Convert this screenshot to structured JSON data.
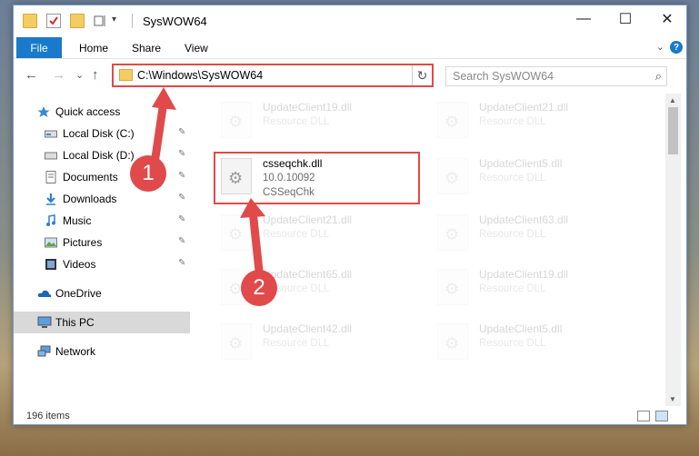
{
  "window": {
    "title": "SysWOW64",
    "minimize": "—",
    "maximize": "☐",
    "close": "✕"
  },
  "ribbon": {
    "tabs": [
      "File",
      "Home",
      "Share",
      "View"
    ],
    "expand": "⌄",
    "help": "?"
  },
  "nav": {
    "back": "←",
    "forward": "→",
    "recent": "⌄",
    "up": "↑",
    "address": "C:\\Windows\\SysWOW64",
    "refresh": "↻",
    "address_dropdown": "⌄",
    "search_placeholder": "Search SysWOW64",
    "search_icon": "⌕"
  },
  "sidebar": {
    "items": [
      {
        "label": "Quick access",
        "icon": "star-icon",
        "pinned": false
      },
      {
        "label": "Local Disk (C:)",
        "icon": "drive-icon",
        "pinned": true
      },
      {
        "label": "Local Disk (D:)",
        "icon": "drive-icon",
        "pinned": true
      },
      {
        "label": "Documents",
        "icon": "documents-icon",
        "pinned": true
      },
      {
        "label": "Downloads",
        "icon": "download-icon",
        "pinned": true
      },
      {
        "label": "Music",
        "icon": "music-icon",
        "pinned": true
      },
      {
        "label": "Pictures",
        "icon": "pictures-icon",
        "pinned": true
      },
      {
        "label": "Videos",
        "icon": "videos-icon",
        "pinned": true
      },
      {
        "label": "OneDrive",
        "icon": "cloud-icon",
        "pinned": false
      },
      {
        "label": "This PC",
        "icon": "pc-icon",
        "pinned": false,
        "selected": true
      },
      {
        "label": "Network",
        "icon": "network-icon",
        "pinned": false
      }
    ],
    "pin_glyph": "📌"
  },
  "files": [
    {
      "name": "UpdateClient19.dll",
      "desc": "Resource DLL",
      "faded": true
    },
    {
      "name": "UpdateClient21.dll",
      "desc": "Resource DLL",
      "faded": true
    },
    {
      "name": "csseqchk.dll",
      "desc": "10.0.10092",
      "desc2": "CSSeqChk",
      "faded": false
    },
    {
      "name": "UpdateClient5.dll",
      "desc": "Resource DLL",
      "faded": true
    },
    {
      "name": "UpdateClient21.dll",
      "desc": "Resource DLL",
      "faded": true
    },
    {
      "name": "UpdateClient63.dll",
      "desc": "Resource DLL",
      "faded": true
    },
    {
      "name": "UpdateClient65.dll",
      "desc": "Resource DLL",
      "faded": true
    },
    {
      "name": "UpdateClient19.dll",
      "desc": "Resource DLL",
      "faded": true
    },
    {
      "name": "UpdateClient42.dll",
      "desc": "Resource DLL",
      "faded": true
    },
    {
      "name": "UpdateClient5.dll",
      "desc": "Resource DLL",
      "faded": true
    }
  ],
  "status": {
    "count": "196 items"
  },
  "annotations": {
    "step1": "1",
    "step2": "2"
  },
  "colors": {
    "accent": "#1979ca",
    "highlight": "#e04a4a"
  }
}
